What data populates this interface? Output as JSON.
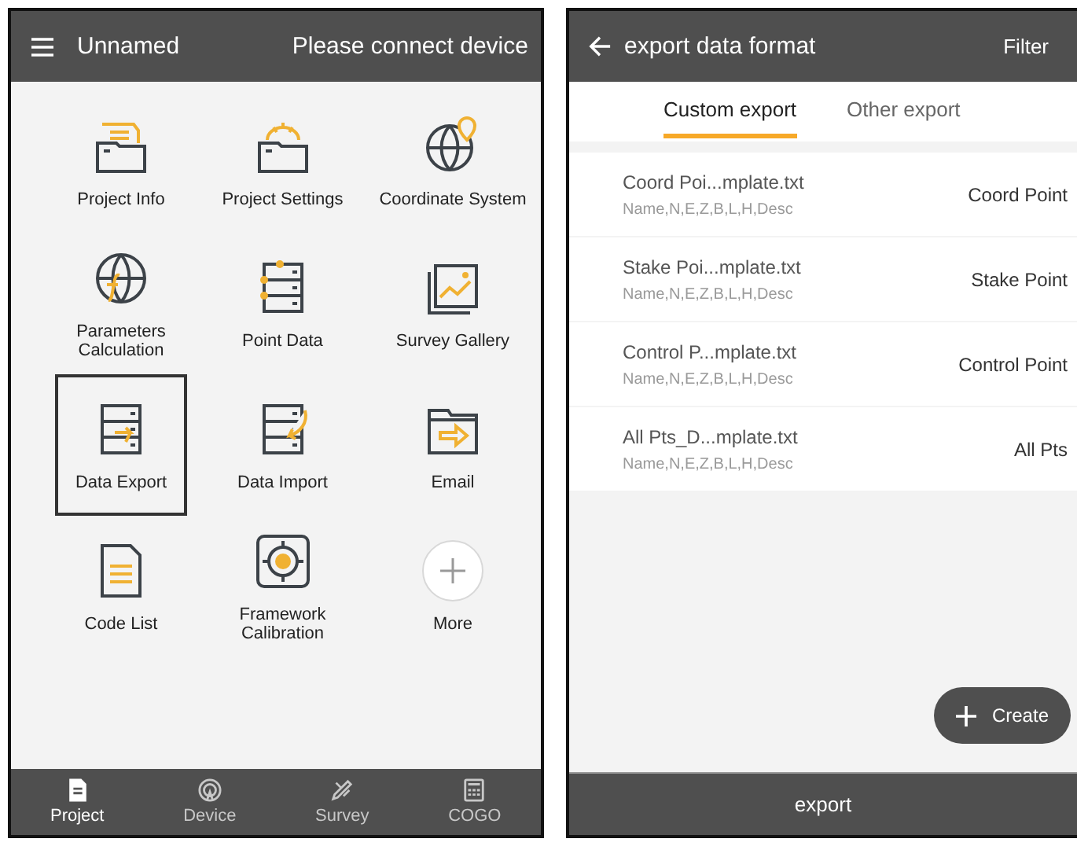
{
  "project_screen": {
    "header": {
      "title": "Unnamed",
      "status": "Please connect device"
    },
    "grid": [
      {
        "label": "Project Info",
        "selected": false
      },
      {
        "label": "Project Settings",
        "selected": false
      },
      {
        "label": "Coordinate System",
        "selected": false
      },
      {
        "label": "Parameters Calculation",
        "selected": false
      },
      {
        "label": "Point Data",
        "selected": false
      },
      {
        "label": "Survey Gallery",
        "selected": false
      },
      {
        "label": "Data Export",
        "selected": true
      },
      {
        "label": "Data Import",
        "selected": false
      },
      {
        "label": "Email",
        "selected": false
      },
      {
        "label": "Code List",
        "selected": false
      },
      {
        "label": "Framework Calibration",
        "selected": false
      },
      {
        "label": "More",
        "selected": false
      }
    ],
    "bottom_nav": [
      {
        "label": "Project",
        "selected": true
      },
      {
        "label": "Device",
        "selected": false
      },
      {
        "label": "Survey",
        "selected": false
      },
      {
        "label": "COGO",
        "selected": false
      }
    ]
  },
  "export_screen": {
    "header": {
      "title": "export data format",
      "action": "Filter"
    },
    "tabs": [
      {
        "label": "Custom export",
        "selected": true
      },
      {
        "label": "Other export",
        "selected": false
      }
    ],
    "templates": [
      {
        "file": "Coord Poi...mplate.txt",
        "fields": "Name,N,E,Z,B,L,H,Desc",
        "type": "Coord Point"
      },
      {
        "file": "Stake Poi...mplate.txt",
        "fields": "Name,N,E,Z,B,L,H,Desc",
        "type": "Stake Point"
      },
      {
        "file": "Control P...mplate.txt",
        "fields": "Name,N,E,Z,B,L,H,Desc",
        "type": "Control Point"
      },
      {
        "file": "All Pts_D...mplate.txt",
        "fields": "Name,N,E,Z,B,L,H,Desc",
        "type": "All Pts"
      }
    ],
    "create_button": "Create",
    "footer_button": "export"
  }
}
